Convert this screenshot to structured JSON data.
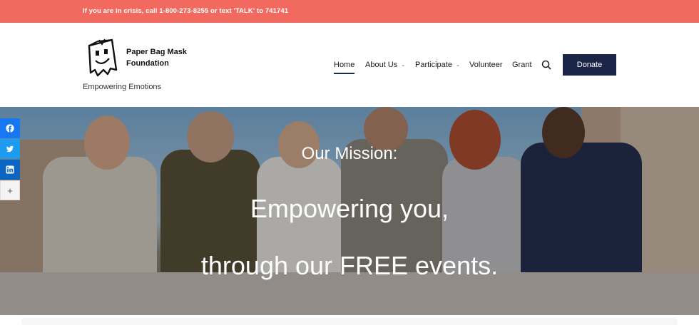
{
  "topbar": {
    "crisis_text": "If you are in crisis, call 1-800-273-8255 or text 'TALK' to 741741"
  },
  "header": {
    "logo_line1": "Paper Bag Mask",
    "logo_line2": "Foundation",
    "tagline": "Empowering Emotions",
    "logo_icon": "paper-bag-mask-icon"
  },
  "nav": {
    "items": [
      {
        "label": "Home",
        "active": true,
        "has_dropdown": false
      },
      {
        "label": "About Us",
        "active": false,
        "has_dropdown": true
      },
      {
        "label": "Participate",
        "active": false,
        "has_dropdown": true
      },
      {
        "label": "Volunteer",
        "active": false,
        "has_dropdown": false
      },
      {
        "label": "Grant",
        "active": false,
        "has_dropdown": false
      }
    ],
    "search_icon": "search-icon",
    "donate_label": "Donate"
  },
  "hero": {
    "subtitle": "Our Mission:",
    "line1": "Empowering you,",
    "line2": "through our FREE events."
  },
  "share": {
    "items": [
      "facebook-icon",
      "twitter-icon",
      "linkedin-icon",
      "plus-icon"
    ],
    "more_label": "+"
  },
  "colors": {
    "topbar": "#f26a5f",
    "donate": "#1b2547",
    "facebook": "#1877f2",
    "twitter": "#1d9bf0",
    "linkedin": "#0a66c2"
  }
}
